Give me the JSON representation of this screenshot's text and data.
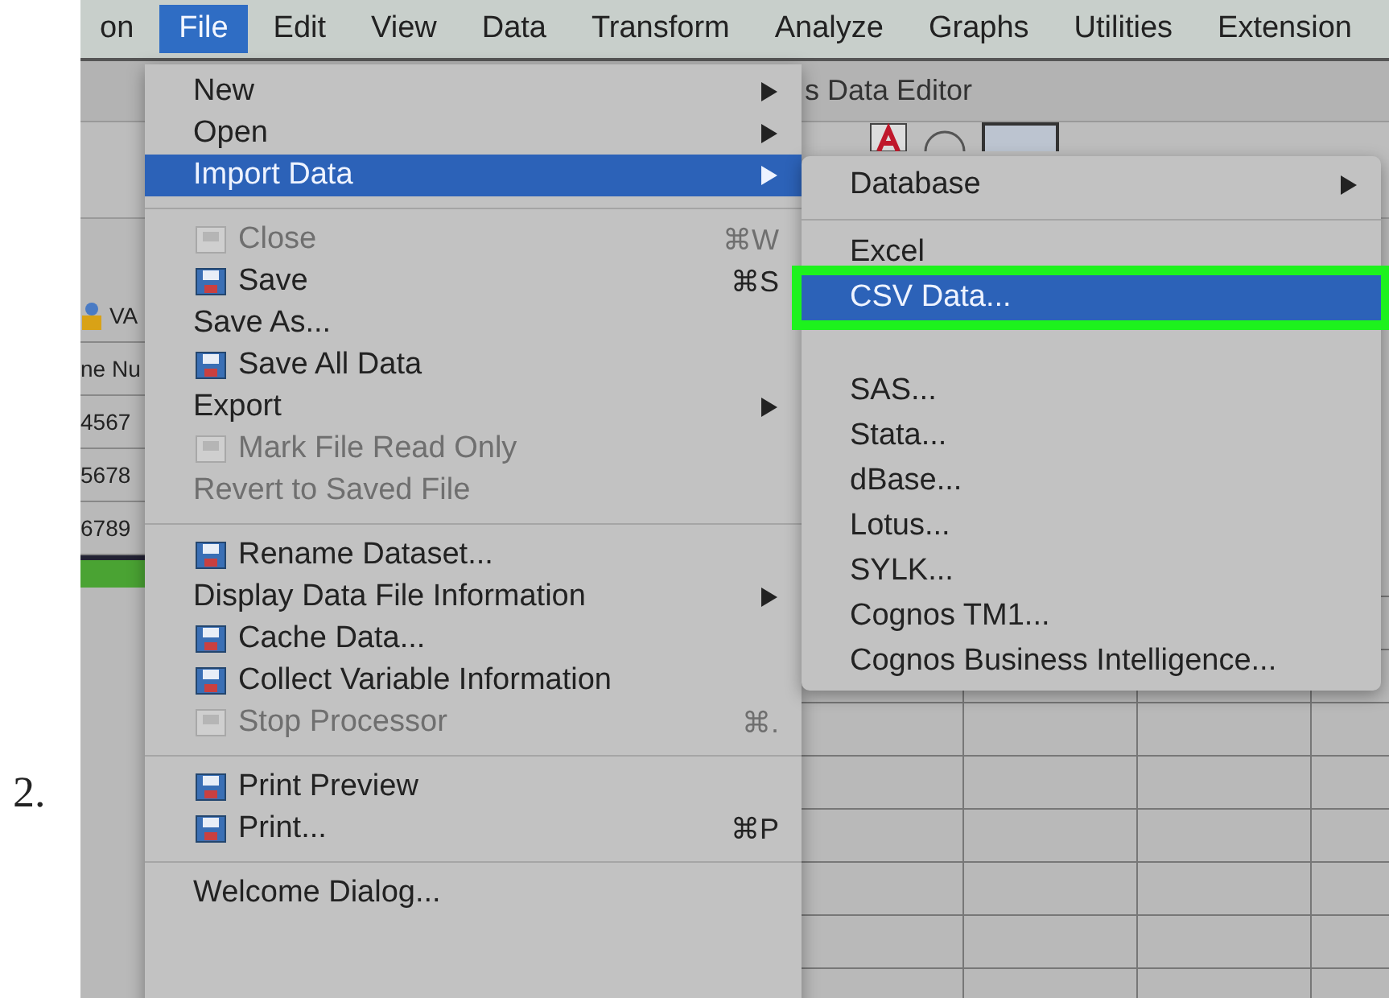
{
  "step_number": "2.",
  "menu_bar": [
    {
      "label": "on",
      "selected": false
    },
    {
      "label": "File",
      "selected": true
    },
    {
      "label": "Edit",
      "selected": false
    },
    {
      "label": "View",
      "selected": false
    },
    {
      "label": "Data",
      "selected": false
    },
    {
      "label": "Transform",
      "selected": false
    },
    {
      "label": "Analyze",
      "selected": false
    },
    {
      "label": "Graphs",
      "selected": false
    },
    {
      "label": "Utilities",
      "selected": false
    },
    {
      "label": "Extension",
      "selected": false
    }
  ],
  "window_title": "s Data Editor",
  "data_view": {
    "variable_header": "VA",
    "label_header": "ne Nu",
    "cells": [
      "4567",
      "5678",
      "6789"
    ]
  },
  "file_menu": [
    {
      "kind": "item",
      "label": "New",
      "submenu": true,
      "selected": false,
      "disabled": false,
      "has_icon": false
    },
    {
      "kind": "item",
      "label": "Open",
      "submenu": true,
      "selected": false,
      "disabled": false,
      "has_icon": false
    },
    {
      "kind": "item",
      "label": "Import Data",
      "submenu": true,
      "selected": true,
      "disabled": false,
      "has_icon": false
    },
    {
      "kind": "separator"
    },
    {
      "kind": "item",
      "label": "Close",
      "shortcut": "⌘W",
      "submenu": false,
      "selected": false,
      "disabled": true,
      "has_icon": true
    },
    {
      "kind": "item",
      "label": "Save",
      "shortcut": "⌘S",
      "submenu": false,
      "selected": false,
      "disabled": false,
      "has_icon": true
    },
    {
      "kind": "item",
      "label": "Save As...",
      "submenu": false,
      "selected": false,
      "disabled": false,
      "has_icon": false
    },
    {
      "kind": "item",
      "label": "Save All Data",
      "submenu": false,
      "selected": false,
      "disabled": false,
      "has_icon": true
    },
    {
      "kind": "item",
      "label": "Export",
      "submenu": true,
      "selected": false,
      "disabled": false,
      "has_icon": false
    },
    {
      "kind": "item",
      "label": "Mark File Read Only",
      "submenu": false,
      "selected": false,
      "disabled": true,
      "has_icon": true
    },
    {
      "kind": "item",
      "label": "Revert to Saved File",
      "submenu": false,
      "selected": false,
      "disabled": true,
      "has_icon": false
    },
    {
      "kind": "separator"
    },
    {
      "kind": "item",
      "label": "Rename Dataset...",
      "submenu": false,
      "selected": false,
      "disabled": false,
      "has_icon": true
    },
    {
      "kind": "item",
      "label": "Display Data File Information",
      "submenu": true,
      "selected": false,
      "disabled": false,
      "has_icon": false
    },
    {
      "kind": "item",
      "label": "Cache Data...",
      "submenu": false,
      "selected": false,
      "disabled": false,
      "has_icon": true
    },
    {
      "kind": "item",
      "label": "Collect Variable Information",
      "submenu": false,
      "selected": false,
      "disabled": false,
      "has_icon": true
    },
    {
      "kind": "item",
      "label": "Stop Processor",
      "shortcut": "⌘.",
      "submenu": false,
      "selected": false,
      "disabled": true,
      "has_icon": true
    },
    {
      "kind": "separator"
    },
    {
      "kind": "item",
      "label": "Print Preview",
      "submenu": false,
      "selected": false,
      "disabled": false,
      "has_icon": true
    },
    {
      "kind": "item",
      "label": "Print...",
      "shortcut": "⌘P",
      "submenu": false,
      "selected": false,
      "disabled": false,
      "has_icon": true
    },
    {
      "kind": "separator"
    },
    {
      "kind": "item",
      "label": "Welcome Dialog...",
      "submenu": false,
      "selected": false,
      "disabled": false,
      "has_icon": false
    }
  ],
  "import_submenu": [
    {
      "kind": "item",
      "label": "Database",
      "submenu": true,
      "selected": false,
      "highlighted": false
    },
    {
      "kind": "separator"
    },
    {
      "kind": "item",
      "label": "Excel",
      "submenu": false,
      "selected": false,
      "highlighted": false
    },
    {
      "kind": "item",
      "label": "CSV Data...",
      "submenu": false,
      "selected": true,
      "highlighted": true
    },
    {
      "kind": "item",
      "label": "SAS...",
      "submenu": false,
      "selected": false,
      "highlighted": false
    },
    {
      "kind": "item",
      "label": "Stata...",
      "submenu": false,
      "selected": false,
      "highlighted": false
    },
    {
      "kind": "item",
      "label": "dBase...",
      "submenu": false,
      "selected": false,
      "highlighted": false
    },
    {
      "kind": "item",
      "label": "Lotus...",
      "submenu": false,
      "selected": false,
      "highlighted": false
    },
    {
      "kind": "item",
      "label": "SYLK...",
      "submenu": false,
      "selected": false,
      "highlighted": false
    },
    {
      "kind": "item",
      "label": "Cognos TM1...",
      "submenu": false,
      "selected": false,
      "highlighted": false
    },
    {
      "kind": "item",
      "label": "Cognos Business Intelligence...",
      "submenu": false,
      "selected": false,
      "highlighted": false
    }
  ]
}
